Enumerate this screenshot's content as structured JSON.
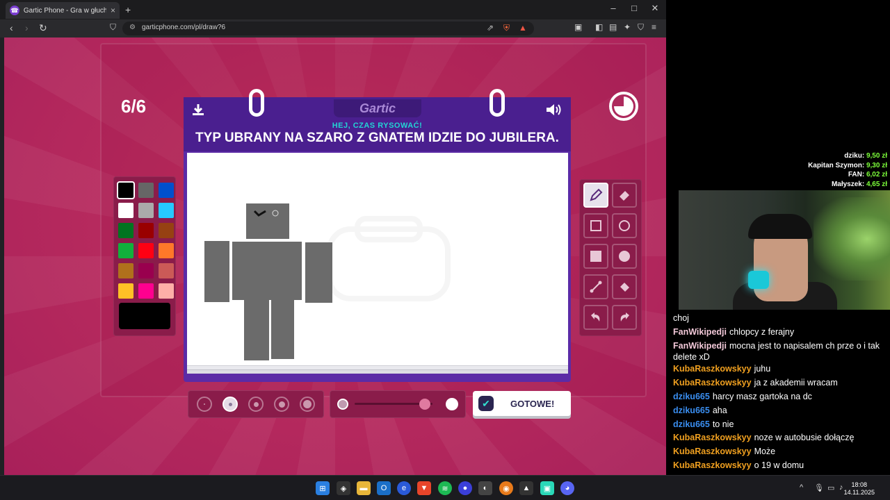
{
  "browser": {
    "tab_title": "Gartic Phone - Gra w głuchy tele",
    "url": "garticphone.com/pl/draw?6"
  },
  "game": {
    "round": "6/6",
    "brand": "Gartic",
    "subtitle": "HEJ, CZAS RYSOWAĆ!",
    "prompt": "TYP UBRANY NA SZARO Z GNATEM IDZIE DO JUBILERA.",
    "done_label": "GOTOWE!",
    "palette": [
      "#000000",
      "#666666",
      "#0050cd",
      "#ffffff",
      "#aaaaaa",
      "#26c9ff",
      "#017420",
      "#990000",
      "#964112",
      "#11b03c",
      "#ff0013",
      "#ff7829",
      "#b0701c",
      "#99004e",
      "#cb5a57",
      "#ffc126",
      "#ff008f",
      "#feafa8"
    ],
    "current_color": "#000000",
    "tools": [
      "pencil-icon",
      "eraser-icon",
      "rectangle-outline-icon",
      "ellipse-outline-icon",
      "rectangle-filled-icon",
      "ellipse-filled-icon",
      "line-icon",
      "bucket-icon",
      "undo-icon",
      "redo-icon"
    ],
    "brush_size_selected_index": 1,
    "opacity_value": 0.9
  },
  "donations": [
    {
      "name": "dziku:",
      "amount": "9,50 zł"
    },
    {
      "name": "Kapitan Szymon:",
      "amount": "9,30 zł"
    },
    {
      "name": "FAN:",
      "amount": "6,02 zł"
    },
    {
      "name": "Małyszek:",
      "amount": "4,65 zł"
    }
  ],
  "chat": [
    {
      "user": "",
      "text": "choj",
      "color": "#ffffff"
    },
    {
      "user": "FanWikipedji",
      "text": "chlopcy z ferajny",
      "color": "#f2c8d8"
    },
    {
      "user": "FanWikipedji",
      "text": "mocna jest to napisalem ch prze o i tak delete xD",
      "color": "#f2c8d8"
    },
    {
      "user": "KubaRaszkowskyy",
      "text": "juhu",
      "color": "#f0a020"
    },
    {
      "user": "KubaRaszkowskyy",
      "text": "ja z akademii wracam",
      "color": "#f0a020"
    },
    {
      "user": "dziku665",
      "text": "harcy masz gartoka na dc",
      "color": "#3a8ef0"
    },
    {
      "user": "dziku665",
      "text": "aha",
      "color": "#3a8ef0"
    },
    {
      "user": "dziku665",
      "text": "to nie",
      "color": "#3a8ef0"
    },
    {
      "user": "KubaRaszkowskyy",
      "text": "noze w autobusie dołączę",
      "color": "#f0a020"
    },
    {
      "user": "KubaRaszkowskyy",
      "text": "Może",
      "color": "#f0a020"
    },
    {
      "user": "KubaRaszkowskyy",
      "text": "o 19 w domu",
      "color": "#f0a020"
    }
  ],
  "taskbar": {
    "time": "18:08",
    "date": "14.11.2025"
  }
}
